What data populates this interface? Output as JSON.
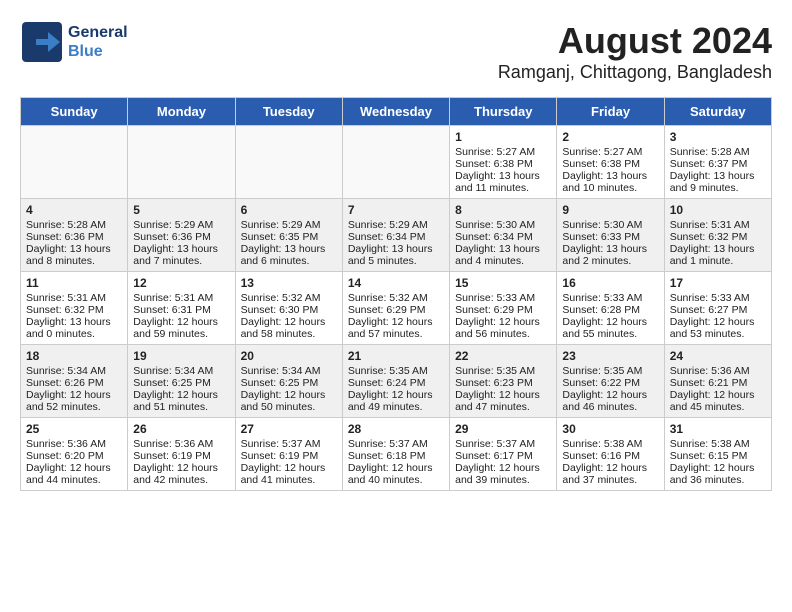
{
  "header": {
    "title": "August 2024",
    "subtitle": "Ramganj, Chittagong, Bangladesh",
    "logo_line1": "General",
    "logo_line2": "Blue"
  },
  "weekdays": [
    "Sunday",
    "Monday",
    "Tuesday",
    "Wednesday",
    "Thursday",
    "Friday",
    "Saturday"
  ],
  "weeks": [
    [
      {
        "day": "",
        "empty": true
      },
      {
        "day": "",
        "empty": true
      },
      {
        "day": "",
        "empty": true
      },
      {
        "day": "",
        "empty": true
      },
      {
        "day": "1",
        "sunrise": "5:27 AM",
        "sunset": "6:38 PM",
        "daylight": "13 hours and 11 minutes."
      },
      {
        "day": "2",
        "sunrise": "5:27 AM",
        "sunset": "6:38 PM",
        "daylight": "13 hours and 10 minutes."
      },
      {
        "day": "3",
        "sunrise": "5:28 AM",
        "sunset": "6:37 PM",
        "daylight": "13 hours and 9 minutes."
      }
    ],
    [
      {
        "day": "4",
        "sunrise": "5:28 AM",
        "sunset": "6:36 PM",
        "daylight": "13 hours and 8 minutes."
      },
      {
        "day": "5",
        "sunrise": "5:29 AM",
        "sunset": "6:36 PM",
        "daylight": "13 hours and 7 minutes."
      },
      {
        "day": "6",
        "sunrise": "5:29 AM",
        "sunset": "6:35 PM",
        "daylight": "13 hours and 6 minutes."
      },
      {
        "day": "7",
        "sunrise": "5:29 AM",
        "sunset": "6:34 PM",
        "daylight": "13 hours and 5 minutes."
      },
      {
        "day": "8",
        "sunrise": "5:30 AM",
        "sunset": "6:34 PM",
        "daylight": "13 hours and 4 minutes."
      },
      {
        "day": "9",
        "sunrise": "5:30 AM",
        "sunset": "6:33 PM",
        "daylight": "13 hours and 2 minutes."
      },
      {
        "day": "10",
        "sunrise": "5:31 AM",
        "sunset": "6:32 PM",
        "daylight": "13 hours and 1 minute."
      }
    ],
    [
      {
        "day": "11",
        "sunrise": "5:31 AM",
        "sunset": "6:32 PM",
        "daylight": "13 hours and 0 minutes."
      },
      {
        "day": "12",
        "sunrise": "5:31 AM",
        "sunset": "6:31 PM",
        "daylight": "12 hours and 59 minutes."
      },
      {
        "day": "13",
        "sunrise": "5:32 AM",
        "sunset": "6:30 PM",
        "daylight": "12 hours and 58 minutes."
      },
      {
        "day": "14",
        "sunrise": "5:32 AM",
        "sunset": "6:29 PM",
        "daylight": "12 hours and 57 minutes."
      },
      {
        "day": "15",
        "sunrise": "5:33 AM",
        "sunset": "6:29 PM",
        "daylight": "12 hours and 56 minutes."
      },
      {
        "day": "16",
        "sunrise": "5:33 AM",
        "sunset": "6:28 PM",
        "daylight": "12 hours and 55 minutes."
      },
      {
        "day": "17",
        "sunrise": "5:33 AM",
        "sunset": "6:27 PM",
        "daylight": "12 hours and 53 minutes."
      }
    ],
    [
      {
        "day": "18",
        "sunrise": "5:34 AM",
        "sunset": "6:26 PM",
        "daylight": "12 hours and 52 minutes."
      },
      {
        "day": "19",
        "sunrise": "5:34 AM",
        "sunset": "6:25 PM",
        "daylight": "12 hours and 51 minutes."
      },
      {
        "day": "20",
        "sunrise": "5:34 AM",
        "sunset": "6:25 PM",
        "daylight": "12 hours and 50 minutes."
      },
      {
        "day": "21",
        "sunrise": "5:35 AM",
        "sunset": "6:24 PM",
        "daylight": "12 hours and 49 minutes."
      },
      {
        "day": "22",
        "sunrise": "5:35 AM",
        "sunset": "6:23 PM",
        "daylight": "12 hours and 47 minutes."
      },
      {
        "day": "23",
        "sunrise": "5:35 AM",
        "sunset": "6:22 PM",
        "daylight": "12 hours and 46 minutes."
      },
      {
        "day": "24",
        "sunrise": "5:36 AM",
        "sunset": "6:21 PM",
        "daylight": "12 hours and 45 minutes."
      }
    ],
    [
      {
        "day": "25",
        "sunrise": "5:36 AM",
        "sunset": "6:20 PM",
        "daylight": "12 hours and 44 minutes."
      },
      {
        "day": "26",
        "sunrise": "5:36 AM",
        "sunset": "6:19 PM",
        "daylight": "12 hours and 42 minutes."
      },
      {
        "day": "27",
        "sunrise": "5:37 AM",
        "sunset": "6:19 PM",
        "daylight": "12 hours and 41 minutes."
      },
      {
        "day": "28",
        "sunrise": "5:37 AM",
        "sunset": "6:18 PM",
        "daylight": "12 hours and 40 minutes."
      },
      {
        "day": "29",
        "sunrise": "5:37 AM",
        "sunset": "6:17 PM",
        "daylight": "12 hours and 39 minutes."
      },
      {
        "day": "30",
        "sunrise": "5:38 AM",
        "sunset": "6:16 PM",
        "daylight": "12 hours and 37 minutes."
      },
      {
        "day": "31",
        "sunrise": "5:38 AM",
        "sunset": "6:15 PM",
        "daylight": "12 hours and 36 minutes."
      }
    ]
  ]
}
